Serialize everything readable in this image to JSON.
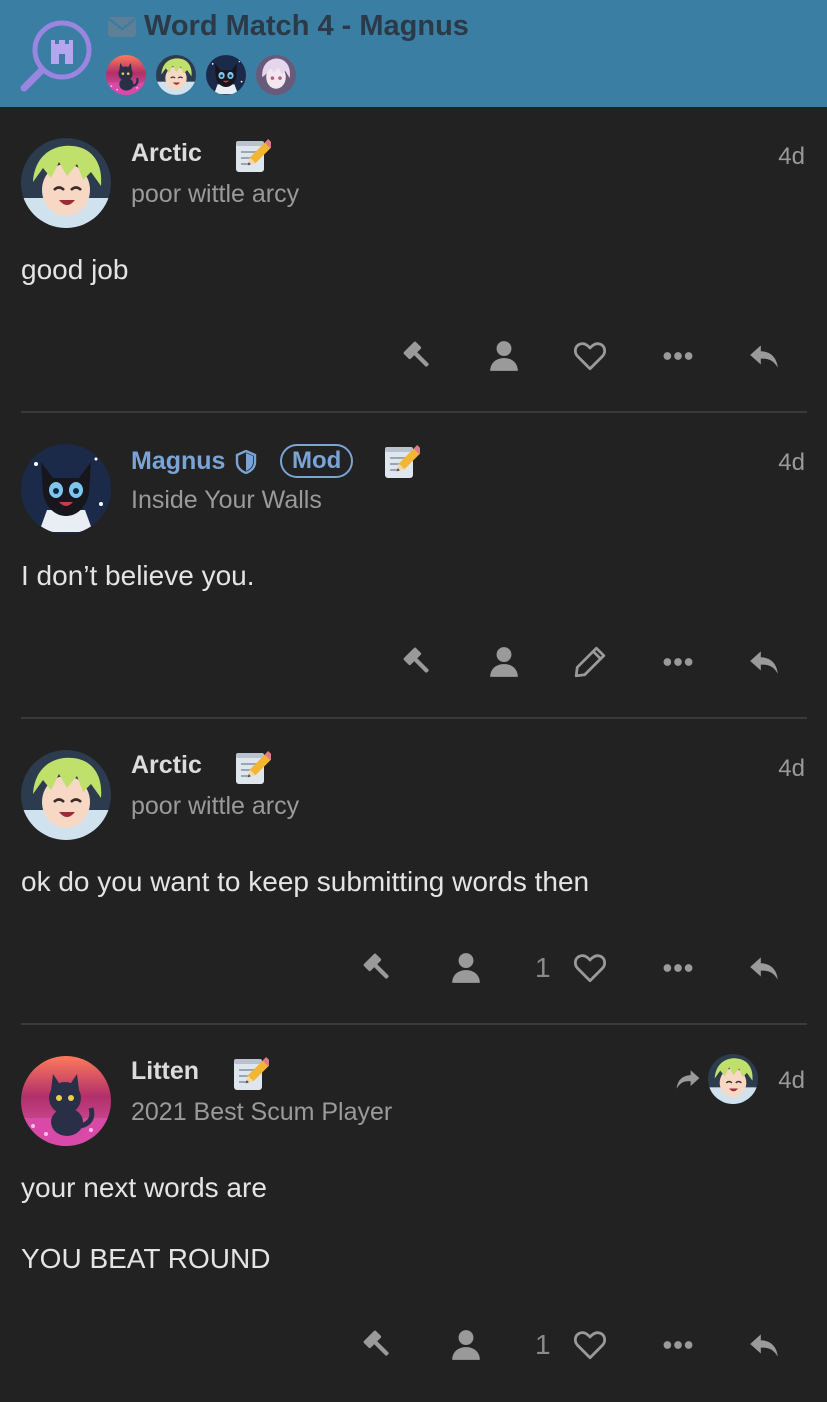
{
  "topic": {
    "title": "Word Match 4 - Magnus",
    "logo_icon": "castle-magnifier-logo",
    "message_icon": "envelope-icon",
    "participants": [
      "Litten",
      "Arctic",
      "Magnus",
      "Participant 4"
    ]
  },
  "posts": [
    {
      "author": "Arctic",
      "title": "poor wittle arcy",
      "time": "4d",
      "lines": [
        "good job"
      ],
      "likes": "",
      "actions": [
        "gavel-icon",
        "user-icon",
        "heart-icon",
        "more-icon",
        "reply-icon"
      ]
    },
    {
      "author": "Magnus",
      "badge": "Mod",
      "title": "Inside Your Walls",
      "time": "4d",
      "lines": [
        "I don’t believe you."
      ],
      "likes": "",
      "actions": [
        "gavel-icon",
        "user-icon",
        "edit-icon",
        "more-icon",
        "reply-icon"
      ]
    },
    {
      "author": "Arctic",
      "title": "poor wittle arcy",
      "time": "4d",
      "lines": [
        "ok do you want to keep submitting words then"
      ],
      "likes": "1",
      "actions": [
        "gavel-icon",
        "user-icon",
        "heart-icon",
        "more-icon",
        "reply-icon"
      ]
    },
    {
      "author": "Litten",
      "title": "2021 Best Scum Player",
      "time": "4d",
      "reply_to": "Arctic",
      "lines": [
        "your next words are",
        "YOU BEAT ROUND"
      ],
      "likes": "1",
      "actions": [
        "gavel-icon",
        "user-icon",
        "heart-icon",
        "more-icon",
        "reply-icon"
      ]
    }
  ],
  "colors": {
    "header_bg": "#3a7ea3",
    "page_bg": "#222222",
    "mod_accent": "#7aa3d6"
  }
}
